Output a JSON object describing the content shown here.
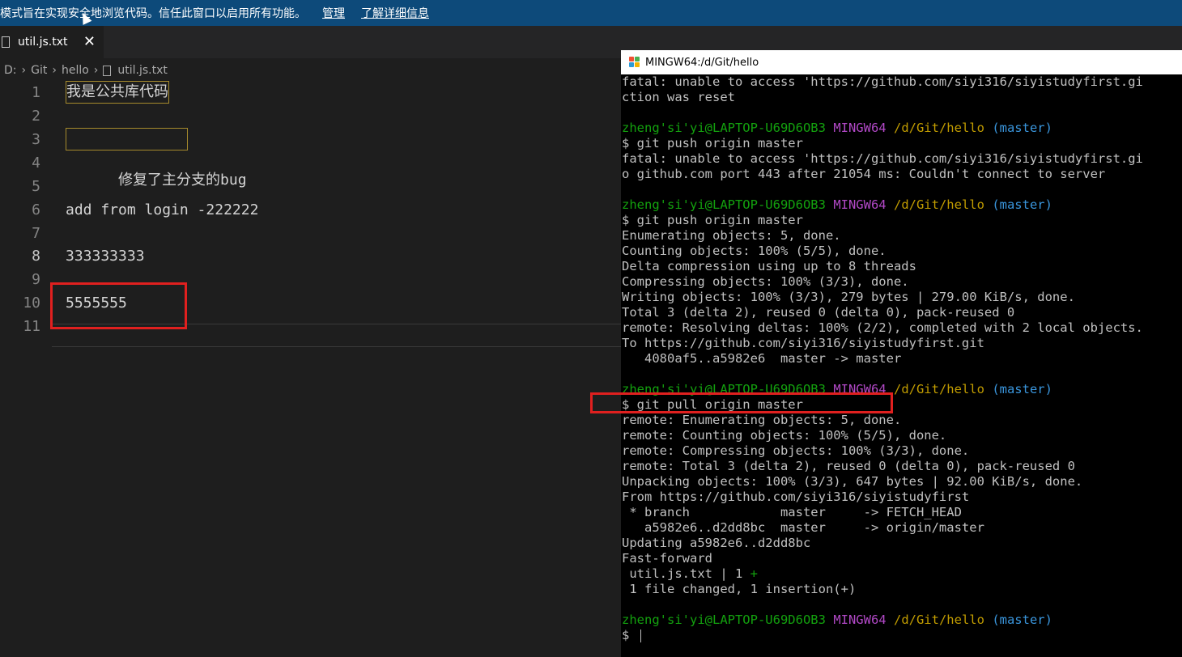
{
  "banner": {
    "message": "模式旨在实现安全地浏览代码。信任此窗口以启用所有功能。",
    "manage": "管理",
    "learn_more": "了解详细信息"
  },
  "tab": {
    "filename": "util.js.txt",
    "close": "✕"
  },
  "breadcrumb": {
    "drive": "D:",
    "folder1": "Git",
    "folder2": "hello",
    "file": "util.js.txt"
  },
  "editor": {
    "lines": [
      {
        "num": "1",
        "text": "我是公共库代码"
      },
      {
        "num": "2",
        "text": ""
      },
      {
        "num": "3",
        "text": "修复了主分支的bug"
      },
      {
        "num": "4",
        "text": ""
      },
      {
        "num": "5",
        "text": ""
      },
      {
        "num": "6",
        "text": "add from login -222222"
      },
      {
        "num": "7",
        "text": ""
      },
      {
        "num": "8",
        "text": "333333333"
      },
      {
        "num": "9",
        "text": ""
      },
      {
        "num": "10",
        "text": "5555555"
      },
      {
        "num": "11",
        "text": ""
      }
    ]
  },
  "terminal": {
    "title": "MINGW64:/d/Git/hello",
    "prompt": {
      "user": "zheng'si'yi@LAPTOP-U69D6OB3",
      "env": "MINGW64",
      "path": "/d/Git/hello",
      "branch": "(master)"
    },
    "lines": [
      "fatal: unable to access 'https://github.com/siyi316/siyistudyfirst.gi",
      "ction was reset",
      "",
      "",
      "$ git push origin master",
      "fatal: unable to access 'https://github.com/siyi316/siyistudyfirst.gi",
      "o github.com port 443 after 21054 ms: Couldn't connect to server",
      "",
      "",
      "$ git push origin master",
      "Enumerating objects: 5, done.",
      "Counting objects: 100% (5/5), done.",
      "Delta compression using up to 8 threads",
      "Compressing objects: 100% (3/3), done.",
      "Writing objects: 100% (3/3), 279 bytes | 279.00 KiB/s, done.",
      "Total 3 (delta 2), reused 0 (delta 0), pack-reused 0",
      "remote: Resolving deltas: 100% (2/2), completed with 2 local objects.",
      "To https://github.com/siyi316/siyistudyfirst.git",
      "   4080af5..a5982e6  master -> master",
      "",
      "",
      "$ git pull origin master",
      "remote: Enumerating objects: 5, done.",
      "remote: Counting objects: 100% (5/5), done.",
      "remote: Compressing objects: 100% (3/3), done.",
      "remote: Total 3 (delta 2), reused 0 (delta 0), pack-reused 0",
      "Unpacking objects: 100% (3/3), 647 bytes | 92.00 KiB/s, done.",
      "From https://github.com/siyi316/siyistudyfirst",
      " * branch            master     -> FETCH_HEAD",
      "   a5982e6..d2dd8bc  master     -> origin/master",
      "Updating a5982e6..d2dd8bc",
      "Fast-forward",
      " util.js.txt | 1 ",
      " 1 file changed, 1 insertion(+)",
      "",
      "",
      "$ "
    ],
    "plus": "+"
  },
  "colors": {
    "banner_bg": "#0d4a7a",
    "prompt_user": "#13a10e",
    "prompt_env": "#b148c6",
    "prompt_path": "#c19c00",
    "prompt_branch": "#3a96dd",
    "highlight_box": "#e0201f"
  }
}
